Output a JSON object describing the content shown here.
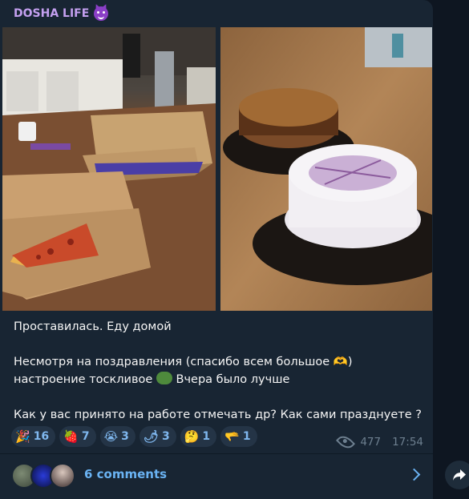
{
  "channel": {
    "name": "DOSHA LIFE",
    "icon": "smiling-devil-icon"
  },
  "photos": [
    {
      "name": "pizza-photo",
      "description_icon": "image"
    },
    {
      "name": "cakes-photo",
      "description_icon": "image"
    }
  ],
  "message": {
    "line1": "Проставилась. Еду домой",
    "line2": "Несмотря на поздравления (спасибо всем большое 🫶)",
    "line3a": "настроение тоскливое",
    "line3b": "Вчера было лучше",
    "line4": "Как у вас принято на работе отмечать др? Как сами празднуете ?"
  },
  "reactions": [
    {
      "emoji": "🎉",
      "count": "16"
    },
    {
      "emoji": "🍓",
      "count": "7"
    },
    {
      "emoji": "😭",
      "count": "3"
    },
    {
      "emoji": "🌶",
      "count": "3"
    },
    {
      "emoji": "🤔",
      "count": "1"
    },
    {
      "emoji": "🫳",
      "count": "1"
    }
  ],
  "meta": {
    "views": "477",
    "time": "17:54"
  },
  "comments": {
    "label": "6 comments"
  },
  "colors": {
    "bubble": "#182533",
    "background": "#0e1621",
    "accent": "#6ab3f3",
    "channel": "#c4a0f0"
  }
}
